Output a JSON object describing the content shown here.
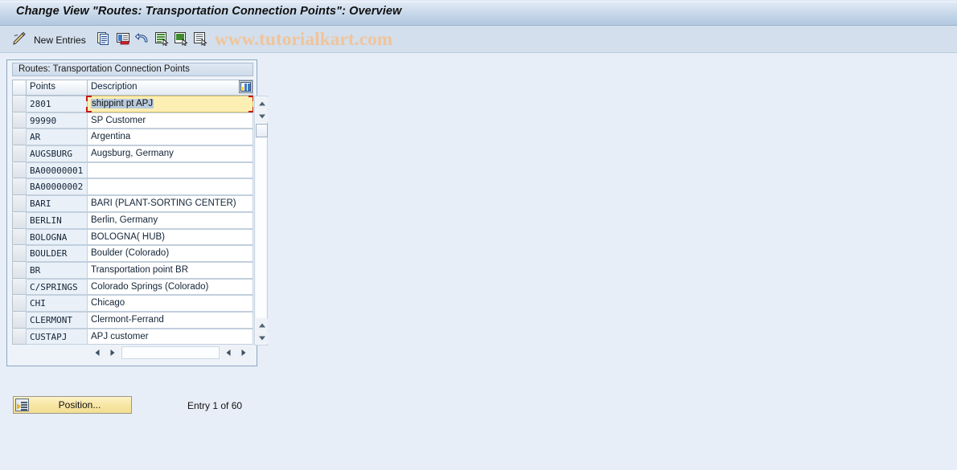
{
  "window": {
    "title": "Change View \"Routes: Transportation Connection Points\": Overview"
  },
  "toolbar": {
    "pencil_icon": "pencil-icon",
    "new_entries_label": "New Entries",
    "icons": [
      {
        "name": "copy-as-icon"
      },
      {
        "name": "delete-icon"
      },
      {
        "name": "undo-icon"
      },
      {
        "name": "select-all-icon"
      },
      {
        "name": "deselect-all-icon"
      },
      {
        "name": "variant-list-icon"
      }
    ]
  },
  "watermark": "www.tutorialkart.com",
  "table": {
    "caption": "Routes: Transportation Connection Points",
    "settings_icon": "table-settings-icon",
    "columns": [
      "Points",
      "Description"
    ],
    "rows": [
      {
        "points": "2801",
        "description": "shippint pt APJ",
        "focused": true
      },
      {
        "points": "99990",
        "description": "SP Customer",
        "focused": false
      },
      {
        "points": "AR",
        "description": "Argentina",
        "focused": false
      },
      {
        "points": "AUGSBURG",
        "description": "Augsburg, Germany",
        "focused": false
      },
      {
        "points": "BA00000001",
        "description": "",
        "focused": false
      },
      {
        "points": "BA00000002",
        "description": "",
        "focused": false
      },
      {
        "points": "BARI",
        "description": "BARI (PLANT-SORTING CENTER)",
        "focused": false
      },
      {
        "points": "BERLIN",
        "description": "Berlin, Germany",
        "focused": false
      },
      {
        "points": "BOLOGNA",
        "description": "BOLOGNA( HUB)",
        "focused": false
      },
      {
        "points": "BOULDER",
        "description": "Boulder (Colorado)",
        "focused": false
      },
      {
        "points": "BR",
        "description": "Transportation point BR",
        "focused": false
      },
      {
        "points": "C/SPRINGS",
        "description": "Colorado Springs (Colorado)",
        "focused": false
      },
      {
        "points": "CHI",
        "description": "Chicago",
        "focused": false
      },
      {
        "points": "CLERMONT",
        "description": "Clermont-Ferrand",
        "focused": false
      },
      {
        "points": "CUSTAPJ",
        "description": "APJ customer",
        "focused": false
      }
    ]
  },
  "footer": {
    "position_button_label": "Position...",
    "entry_status": "Entry 1 of 60"
  },
  "colors": {
    "title_bar": "#c3d5e8",
    "toolbar": "#d3dfec",
    "page_background": "#e8eef7",
    "focus_cell": "#fdeeb4",
    "focus_border": "#c31a1a",
    "watermark": "#f0c49a",
    "button": "#f8e6a4"
  }
}
